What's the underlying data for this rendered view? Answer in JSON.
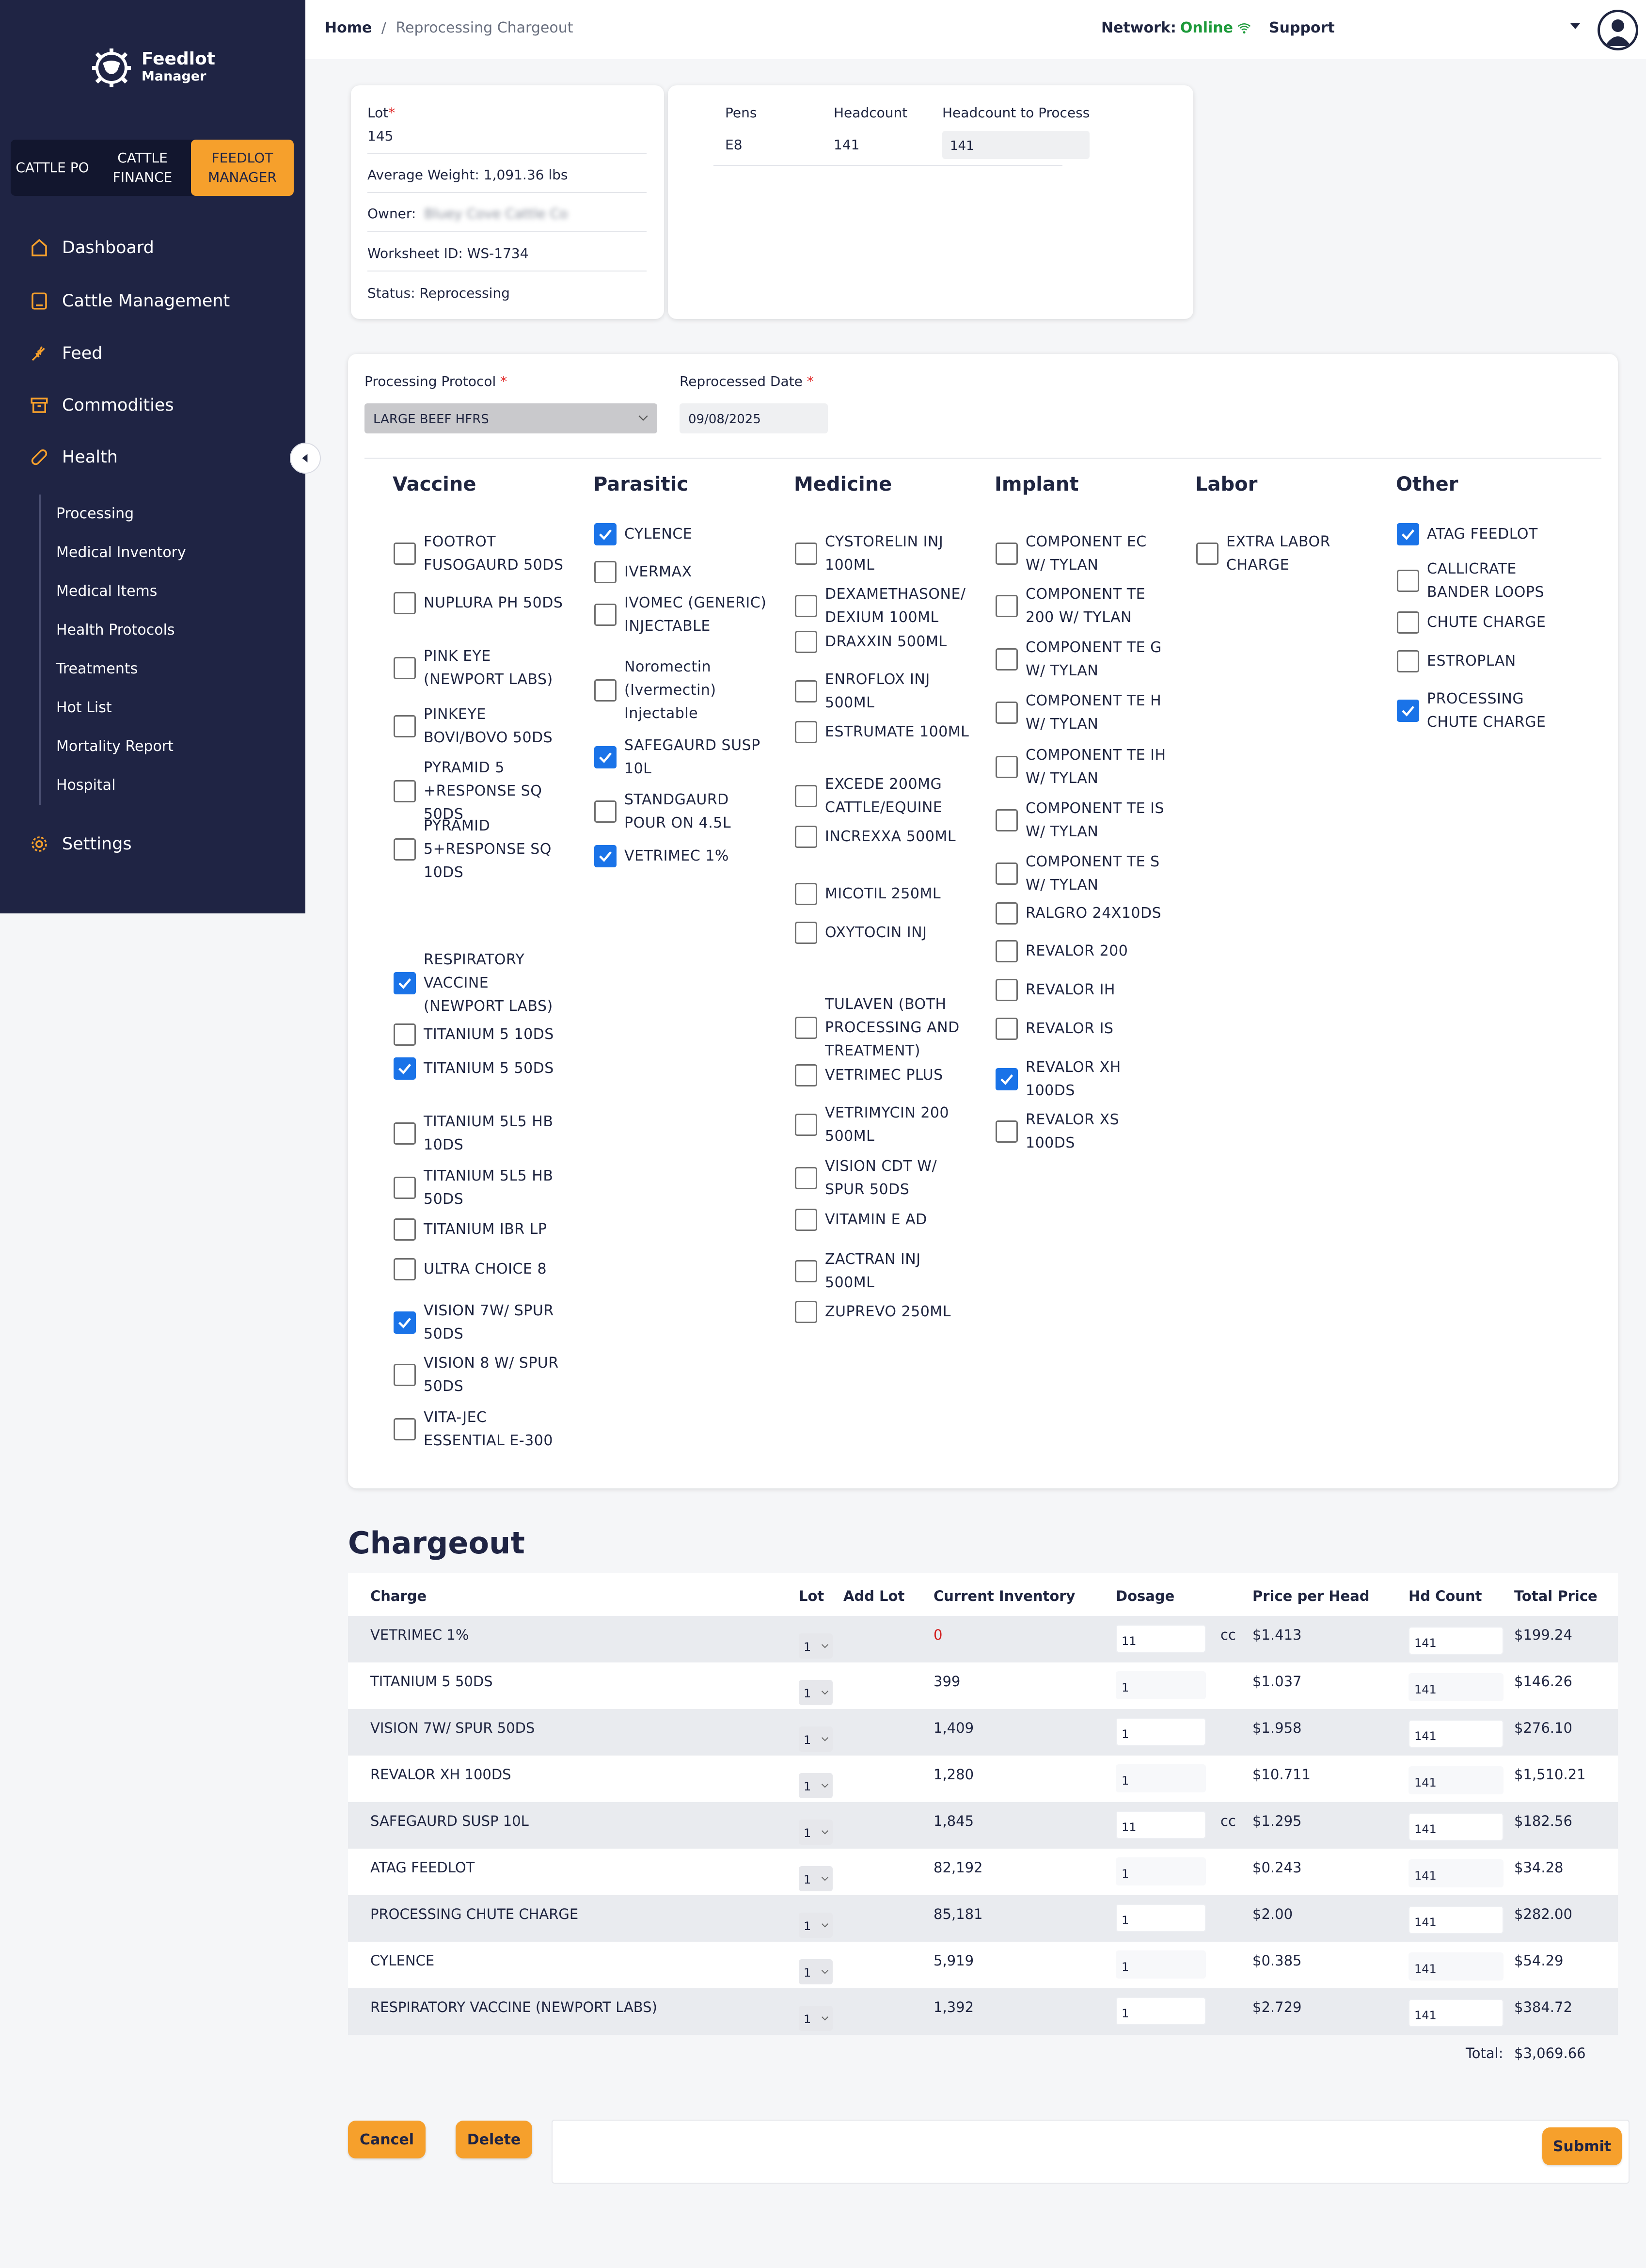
{
  "brand": {
    "name": "Feedlot",
    "sub": "Manager"
  },
  "app_switch": [
    "CATTLE PO",
    "CATTLE FINANCE",
    "FEEDLOT MANAGER"
  ],
  "nav": {
    "dashboard": "Dashboard",
    "cattle": "Cattle Management",
    "feed": "Feed",
    "commodities": "Commodities",
    "health": "Health",
    "settings": "Settings",
    "health_sub": [
      "Processing",
      "Medical Inventory",
      "Medical Items",
      "Health Protocols",
      "Treatments",
      "Hot List",
      "Mortality Report",
      "Hospital"
    ]
  },
  "topbar": {
    "breadcrumb_home": "Home",
    "breadcrumb_sep": "/",
    "breadcrumb_current": "Reprocessing Chargeout",
    "network_label": "Network:",
    "network_status": "Online",
    "support": "Support"
  },
  "lot_info": {
    "lot_label": "Lot",
    "lot_value": "145",
    "avg_weight": "Average Weight: 1,091.36 lbs",
    "owner_label": "Owner:",
    "owner_value": "Bluey Cove Cattle Co",
    "worksheet": "Worksheet ID: WS-1734",
    "status": "Status: Reprocessing"
  },
  "pens": {
    "pens_label": "Pens",
    "headcount_label": "Headcount",
    "htp_label": "Headcount to Process",
    "pen": "E8",
    "headcount": "141",
    "htp": "141"
  },
  "protocol": {
    "protocol_label": "Processing Protocol",
    "protocol_value": "LARGE BEEF HFRS",
    "date_label": "Reprocessed Date",
    "date_value": "09/08/2025"
  },
  "categories": {
    "vaccine": {
      "title": "Vaccine",
      "items": [
        {
          "label": "FOOTROT FUSOGAURD 50DS",
          "checked": false
        },
        {
          "label": "NUPLURA PH 50DS",
          "checked": false
        },
        {
          "label": "PINK EYE (NEWPORT LABS)",
          "checked": false
        },
        {
          "label": "PINKEYE BOVI/BOVO 50DS",
          "checked": false
        },
        {
          "label": "PYRAMID 5 +RESPONSE SQ 50DS",
          "checked": false
        },
        {
          "label": "PYRAMID 5+RESPONSE SQ 10DS",
          "checked": false
        },
        {
          "label": "RESPIRATORY VACCINE (NEWPORT LABS)",
          "checked": true
        },
        {
          "label": "TITANIUM 5 10DS",
          "checked": false
        },
        {
          "label": "TITANIUM 5 50DS",
          "checked": true
        },
        {
          "label": "TITANIUM 5L5 HB 10DS",
          "checked": false
        },
        {
          "label": "TITANIUM 5L5 HB 50DS",
          "checked": false
        },
        {
          "label": "TITANIUM IBR LP",
          "checked": false
        },
        {
          "label": "ULTRA CHOICE 8",
          "checked": false
        },
        {
          "label": "VISION 7W/ SPUR 50DS",
          "checked": true
        },
        {
          "label": "VISION 8 W/ SPUR 50DS",
          "checked": false
        },
        {
          "label": "VITA-JEC ESSENTIAL E-300",
          "checked": false
        }
      ]
    },
    "parasitic": {
      "title": "Parasitic",
      "items": [
        {
          "label": "CYLENCE",
          "checked": true
        },
        {
          "label": "IVERMAX",
          "checked": false
        },
        {
          "label": "IVOMEC (GENERIC) INJECTABLE",
          "checked": false
        },
        {
          "label": "Noromectin (Ivermectin) Injectable",
          "checked": false
        },
        {
          "label": "SAFEGAURD SUSP 10L",
          "checked": true
        },
        {
          "label": "STANDGAURD POUR ON 4.5L",
          "checked": false
        },
        {
          "label": "VETRIMEC 1%",
          "checked": true
        }
      ]
    },
    "medicine": {
      "title": "Medicine",
      "items": [
        {
          "label": "CYSTORELIN INJ 100ML",
          "checked": false
        },
        {
          "label": "DEXAMETHASONE/ DEXIUM 100ML",
          "checked": false
        },
        {
          "label": "DRAXXIN 500ML",
          "checked": false
        },
        {
          "label": "ENROFLOX INJ 500ML",
          "checked": false
        },
        {
          "label": "ESTRUMATE 100ML",
          "checked": false
        },
        {
          "label": "EXCEDE 200MG CATTLE/EQUINE",
          "checked": false
        },
        {
          "label": "INCREXXA 500ML",
          "checked": false
        },
        {
          "label": "MICOTIL 250ML",
          "checked": false
        },
        {
          "label": "OXYTOCIN INJ",
          "checked": false
        },
        {
          "label": "TULAVEN (BOTH PROCESSING AND TREATMENT)",
          "checked": false
        },
        {
          "label": "VETRIMEC PLUS",
          "checked": false
        },
        {
          "label": "VETRIMYCIN 200 500ML",
          "checked": false
        },
        {
          "label": "VISION CDT W/ SPUR 50DS",
          "checked": false
        },
        {
          "label": "VITAMIN E AD",
          "checked": false
        },
        {
          "label": "ZACTRAN INJ 500ML",
          "checked": false
        },
        {
          "label": "ZUPREVO 250ML",
          "checked": false
        }
      ]
    },
    "implant": {
      "title": "Implant",
      "items": [
        {
          "label": "COMPONENT EC W/ TYLAN",
          "checked": false
        },
        {
          "label": "COMPONENT TE 200 W/ TYLAN",
          "checked": false
        },
        {
          "label": "COMPONENT TE G W/ TYLAN",
          "checked": false
        },
        {
          "label": "COMPONENT TE H W/ TYLAN",
          "checked": false
        },
        {
          "label": "COMPONENT TE IH W/ TYLAN",
          "checked": false
        },
        {
          "label": "COMPONENT TE IS W/ TYLAN",
          "checked": false
        },
        {
          "label": "COMPONENT TE S W/ TYLAN",
          "checked": false
        },
        {
          "label": "RALGRO 24X10DS",
          "checked": false
        },
        {
          "label": "REVALOR 200",
          "checked": false
        },
        {
          "label": "REVALOR IH",
          "checked": false
        },
        {
          "label": "REVALOR IS",
          "checked": false
        },
        {
          "label": "REVALOR XH 100DS",
          "checked": true
        },
        {
          "label": "REVALOR XS 100DS",
          "checked": false
        }
      ]
    },
    "labor": {
      "title": "Labor",
      "items": [
        {
          "label": "EXTRA LABOR CHARGE",
          "checked": false
        }
      ]
    },
    "other": {
      "title": "Other",
      "items": [
        {
          "label": "ATAG FEEDLOT",
          "checked": true
        },
        {
          "label": "CALLICRATE BANDER LOOPS",
          "checked": false
        },
        {
          "label": "CHUTE CHARGE",
          "checked": false
        },
        {
          "label": "ESTROPLAN",
          "checked": false
        },
        {
          "label": "PROCESSING CHUTE CHARGE",
          "checked": true
        }
      ]
    }
  },
  "chargeout": {
    "title": "Chargeout",
    "headers": {
      "charge": "Charge",
      "lot": "Lot",
      "add_lot": "Add Lot",
      "inventory": "Current Inventory",
      "dosage": "Dosage",
      "price": "Price per Head",
      "hd": "Hd Count",
      "total": "Total Price"
    },
    "rows": [
      {
        "charge": "VETRIMEC 1%",
        "lot": "1",
        "inventory": "0",
        "dosage": "11",
        "unit": "cc",
        "price": "$1.413",
        "hd": "141",
        "total": "$199.24"
      },
      {
        "charge": "TITANIUM 5 50DS",
        "lot": "1",
        "inventory": "399",
        "dosage": "1",
        "unit": "",
        "price": "$1.037",
        "hd": "141",
        "total": "$146.26"
      },
      {
        "charge": "VISION 7W/ SPUR 50DS",
        "lot": "1",
        "inventory": "1,409",
        "dosage": "1",
        "unit": "",
        "price": "$1.958",
        "hd": "141",
        "total": "$276.10"
      },
      {
        "charge": "REVALOR XH 100DS",
        "lot": "1",
        "inventory": "1,280",
        "dosage": "1",
        "unit": "",
        "price": "$10.711",
        "hd": "141",
        "total": "$1,510.21"
      },
      {
        "charge": "SAFEGAURD SUSP 10L",
        "lot": "1",
        "inventory": "1,845",
        "dosage": "11",
        "unit": "cc",
        "price": "$1.295",
        "hd": "141",
        "total": "$182.56"
      },
      {
        "charge": "ATAG FEEDLOT",
        "lot": "1",
        "inventory": "82,192",
        "dosage": "1",
        "unit": "",
        "price": "$0.243",
        "hd": "141",
        "total": "$34.28"
      },
      {
        "charge": "PROCESSING CHUTE CHARGE",
        "lot": "1",
        "inventory": "85,181",
        "dosage": "1",
        "unit": "",
        "price": "$2.00",
        "hd": "141",
        "total": "$282.00"
      },
      {
        "charge": "CYLENCE",
        "lot": "1",
        "inventory": "5,919",
        "dosage": "1",
        "unit": "",
        "price": "$0.385",
        "hd": "141",
        "total": "$54.29"
      },
      {
        "charge": "RESPIRATORY VACCINE (NEWPORT LABS)",
        "lot": "1",
        "inventory": "1,392",
        "dosage": "1",
        "unit": "",
        "price": "$2.729",
        "hd": "141",
        "total": "$384.72"
      }
    ],
    "total_label": "Total:",
    "total_value": "$3,069.66"
  },
  "buttons": {
    "cancel": "Cancel",
    "delete": "Delete",
    "submit": "Submit"
  },
  "colors": {
    "sidebar": "#1f2444",
    "accent": "#f6a02c",
    "online": "#1d9a3a",
    "checkbox": "#1a73e8",
    "alert": "#d11a1a"
  }
}
